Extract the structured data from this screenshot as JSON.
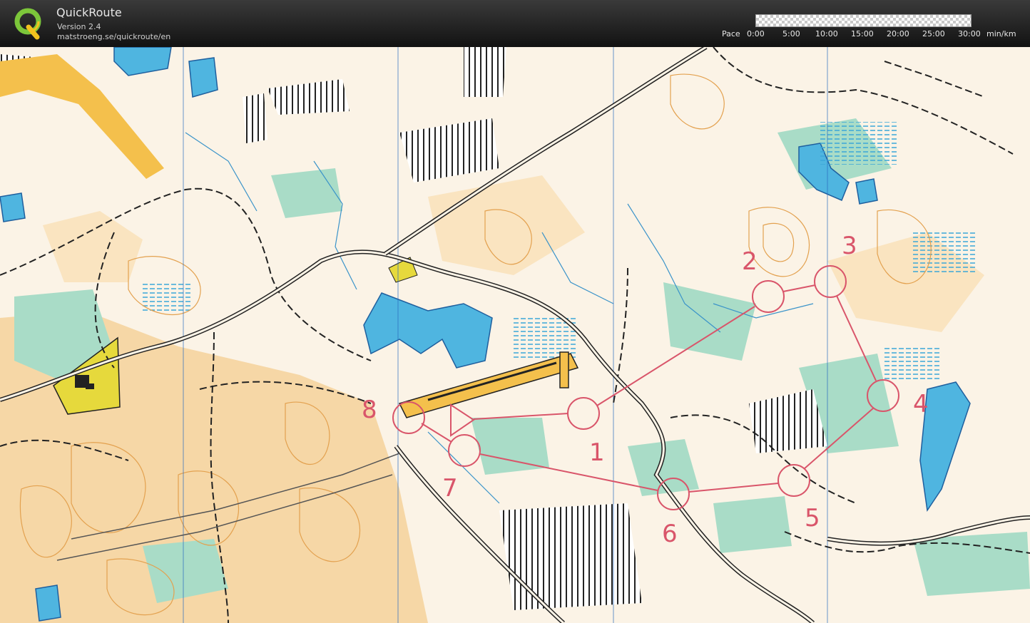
{
  "app": {
    "name": "QuickRoute",
    "version": "Version 2.4",
    "url": "matstroeng.se/quickroute/en"
  },
  "pace_scale": {
    "label": "Pace",
    "ticks": [
      "0:00",
      "5:00",
      "10:00",
      "15:00",
      "20:00",
      "25:00",
      "30:00"
    ],
    "unit": "min/km"
  },
  "course": {
    "color": "#d9556a",
    "controls": [
      "1",
      "2",
      "3",
      "4",
      "5",
      "6",
      "7",
      "8"
    ]
  },
  "map_colors": {
    "open_land": "#f7d9a6",
    "forest": "#ffffff",
    "green": "#a8dcc8",
    "water": "#4ab3e0",
    "contour": "#e2a04f",
    "road": "#222222",
    "settlement": "#e8d84a"
  }
}
